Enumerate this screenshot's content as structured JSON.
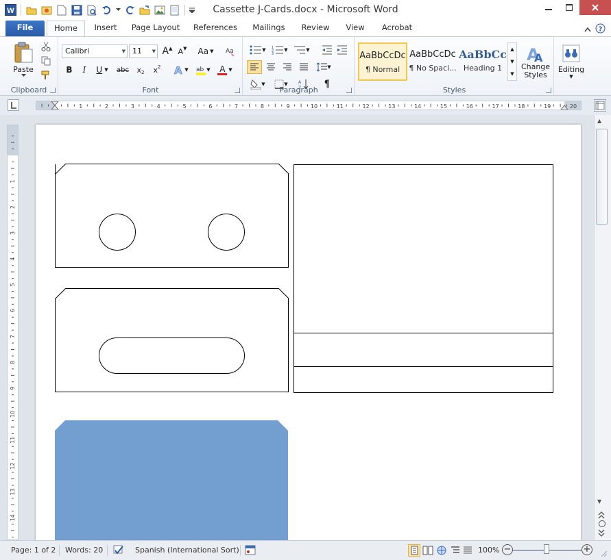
{
  "window": {
    "title": "Cassette J-Cards.docx  -  Microsoft Word",
    "app_icon": "W"
  },
  "tabs": [
    {
      "label": "File"
    },
    {
      "label": "Home"
    },
    {
      "label": "Insert"
    },
    {
      "label": "Page Layout"
    },
    {
      "label": "References"
    },
    {
      "label": "Mailings"
    },
    {
      "label": "Review"
    },
    {
      "label": "View"
    },
    {
      "label": "Acrobat"
    }
  ],
  "ribbon": {
    "clipboard": {
      "label": "Clipboard",
      "paste": "Paste"
    },
    "font": {
      "label": "Font",
      "family": "Calibri",
      "size": "11",
      "grow": "A",
      "shrink": "A",
      "change_case": "Aa",
      "bold": "B",
      "italic": "I",
      "underline": "U",
      "strike": "abc",
      "subscript": "x",
      "superscript": "x",
      "font_color": "A"
    },
    "paragraph": {
      "label": "Paragraph",
      "pilcrow": "¶"
    },
    "styles": {
      "label": "Styles",
      "items": [
        {
          "preview": "AaBbCcDc",
          "label": "¶ Normal"
        },
        {
          "preview": "AaBbCcDc",
          "label": "¶ No Spaci..."
        },
        {
          "preview": "AaBbCc",
          "label": "Heading 1"
        }
      ],
      "change_styles": "Change Styles"
    },
    "editing": {
      "label": "Editing"
    }
  },
  "ruler": {
    "h_labels": [
      "1",
      "2",
      "3",
      "4",
      "5",
      "6",
      "7",
      "8",
      "9",
      "10",
      "11",
      "12",
      "13",
      "14",
      "15",
      "16",
      "17",
      "18",
      "19",
      "20"
    ],
    "v_labels": [
      "1",
      "2",
      "3",
      "4",
      "5",
      "6",
      "7",
      "8",
      "9",
      "10",
      "11",
      "12",
      "13",
      "14"
    ]
  },
  "document": {
    "shape_fill": "#729fcf",
    "line_color": "#000000"
  },
  "status": {
    "page": "Page: 1 of 2",
    "words": "Words: 20",
    "language": "Spanish (International Sort)",
    "zoom": "100%",
    "minus": "−",
    "plus": "+"
  }
}
